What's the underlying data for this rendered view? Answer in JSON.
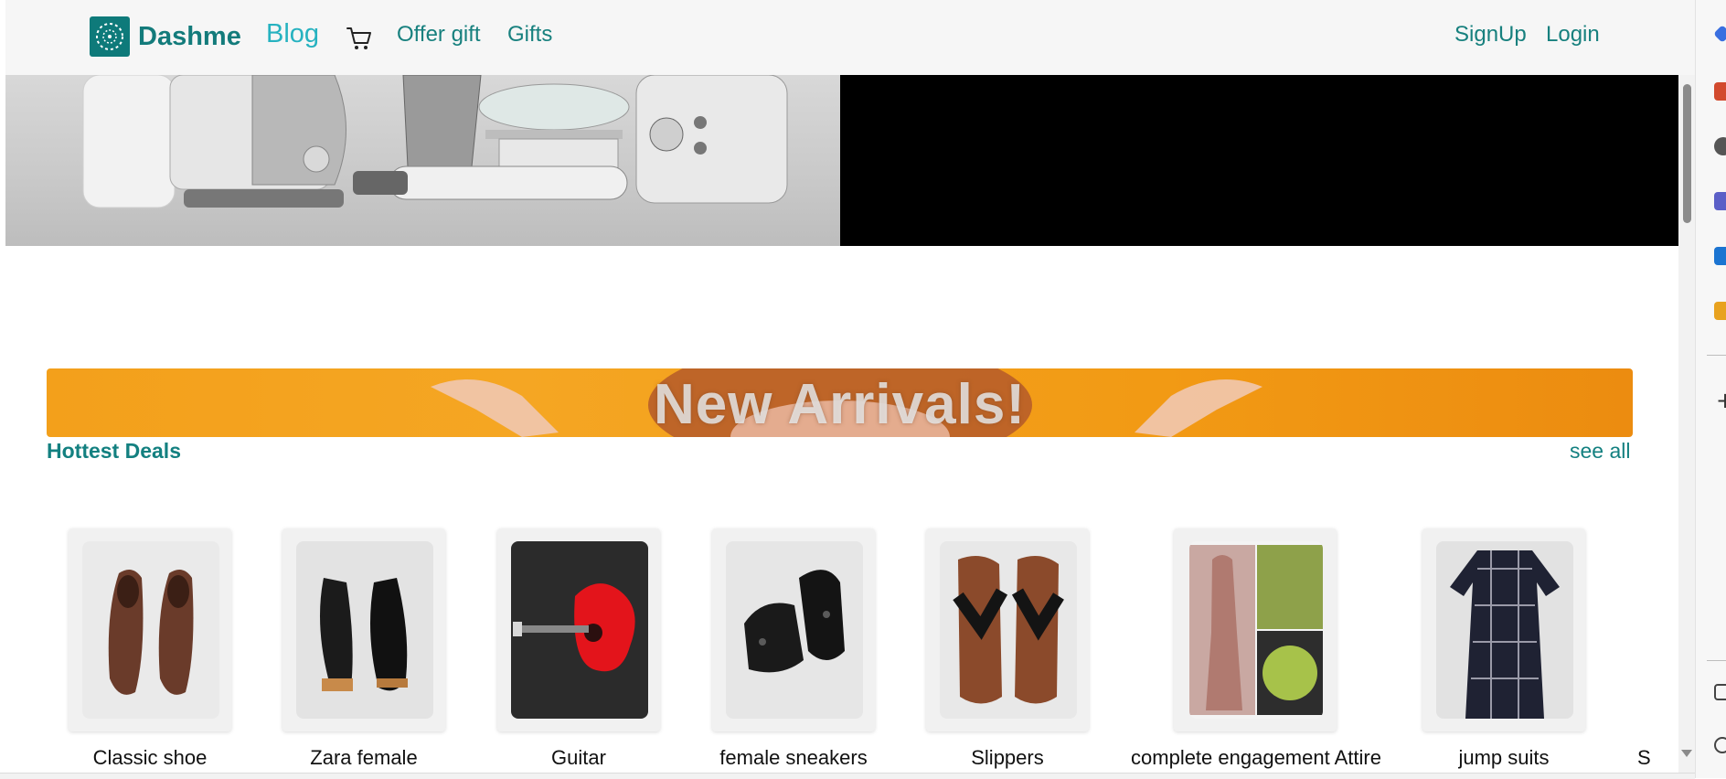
{
  "navbar": {
    "brand": "Dashme",
    "links": {
      "blog": "Blog",
      "offer_gift": "Offer gift",
      "gifts": "Gifts",
      "signup": "SignUp",
      "login": "Login"
    }
  },
  "banner": {
    "title": "New Arrivals!"
  },
  "section": {
    "title": "Hottest Deals",
    "see_all": "see all"
  },
  "products": [
    {
      "name": "Classic shoe",
      "image": "brown-loafers"
    },
    {
      "name": "Zara female",
      "image": "black-platform-shoes"
    },
    {
      "name": "Guitar",
      "image": "red-guitar"
    },
    {
      "name": "female sneakers",
      "image": "black-sneakers"
    },
    {
      "name": "Slippers",
      "image": "thong-slippers"
    },
    {
      "name": "complete engagement Attire",
      "image": "engagement-attire-collage"
    },
    {
      "name": "jump suits",
      "image": "plaid-dress"
    },
    {
      "name": "S",
      "image": ""
    }
  ],
  "colors": {
    "accent": "#138080",
    "banner": "#f5a623",
    "blog": "#26b2c0"
  }
}
